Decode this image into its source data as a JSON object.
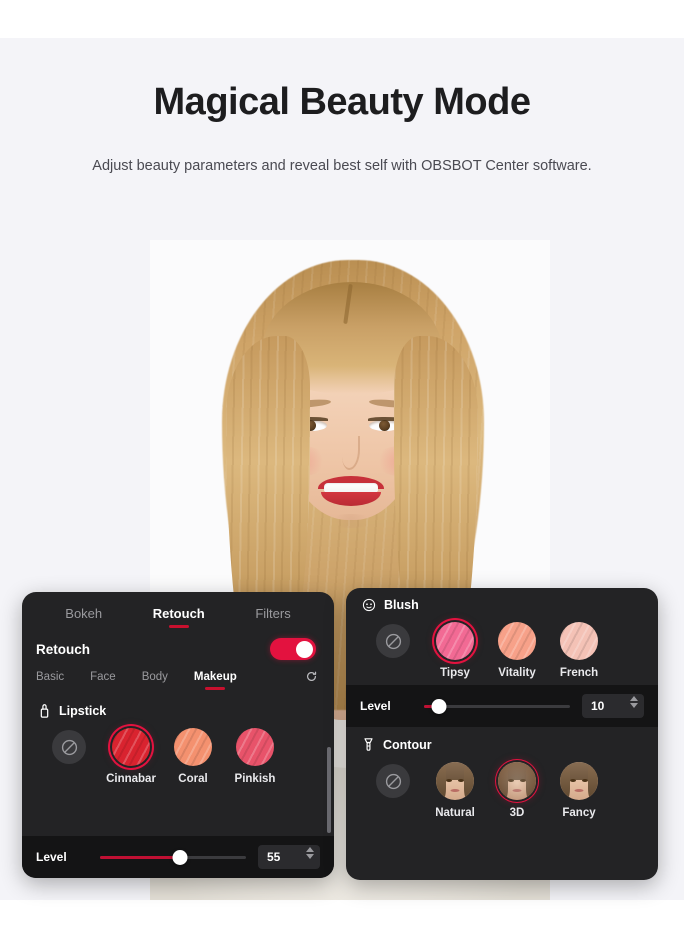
{
  "hero": {
    "title": "Magical Beauty Mode",
    "subtitle": "Adjust beauty parameters and reveal best self with OBSBOT Center software."
  },
  "colors": {
    "accent_red": "#c8102e",
    "toggle_on": "#e3123f",
    "panel_bg": "#232325",
    "level_bar_bg": "#141415",
    "page_bg": "#f4f4f8"
  },
  "left_panel": {
    "main_tabs": [
      {
        "label": "Bokeh",
        "active": false
      },
      {
        "label": "Retouch",
        "active": true
      },
      {
        "label": "Filters",
        "active": false
      }
    ],
    "retouch_row": {
      "label": "Retouch",
      "toggle_state": "on"
    },
    "sub_tabs": [
      {
        "label": "Basic",
        "active": false
      },
      {
        "label": "Face",
        "active": false
      },
      {
        "label": "Body",
        "active": false
      },
      {
        "label": "Makeup",
        "active": true
      }
    ],
    "reset_icon": "refresh-icon",
    "section": {
      "icon": "lipstick-icon",
      "title": "Lipstick",
      "options": [
        {
          "label": "",
          "type": "none",
          "icon": "no-effect-icon",
          "selected": false
        },
        {
          "label": "Cinnabar",
          "color": "#d9232f",
          "selected": true
        },
        {
          "label": "Coral",
          "color": "#f4916f",
          "selected": false
        },
        {
          "label": "Pinkish",
          "color": "#e8536a",
          "selected": false
        }
      ]
    },
    "level": {
      "label": "Level",
      "value": "55",
      "percent": 55
    },
    "scrollbar": "vertical-scrollbar"
  },
  "right_panel": {
    "blush": {
      "icon": "face-circle-icon",
      "title": "Blush",
      "options": [
        {
          "label": "",
          "type": "none",
          "icon": "no-effect-icon",
          "selected": false
        },
        {
          "label": "Tipsy",
          "color": "#f26a94",
          "selected": true
        },
        {
          "label": "Vitality",
          "color": "#f7a189",
          "selected": false
        },
        {
          "label": "French",
          "color": "#f4c2b6",
          "selected": false
        }
      ],
      "level": {
        "label": "Level",
        "value": "10",
        "percent": 10
      }
    },
    "contour": {
      "icon": "makeup-brush-icon",
      "title": "Contour",
      "options": [
        {
          "label": "",
          "type": "none",
          "icon": "no-effect-icon",
          "selected": false
        },
        {
          "label": "Natural",
          "selected": false
        },
        {
          "label": "3D",
          "selected": true
        },
        {
          "label": "Fancy",
          "selected": false
        }
      ]
    }
  }
}
